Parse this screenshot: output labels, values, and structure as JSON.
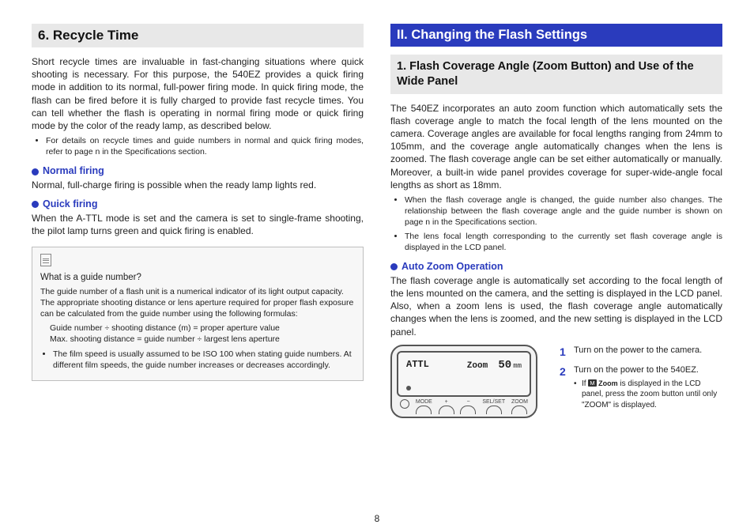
{
  "pageNumber": "8",
  "left": {
    "section_title": "6. Recycle Time",
    "intro": "Short recycle times are invaluable in fast-changing situations where quick shooting is necessary. For this purpose, the 540EZ provides a quick firing mode in addition to its normal, full-power firing mode. In quick firing mode, the flash can be fired before it is fully charged to provide fast recycle times. You can tell whether the flash is operating in normal firing mode or quick firing mode by the color of the ready lamp, as described below.",
    "bullet1": "For details on recycle times and guide numbers in normal and quick firing modes, refer to page n in the Specifications section.",
    "normal_title": "Normal firing",
    "normal_text": "Normal, full-charge firing is possible when the ready lamp lights red.",
    "quick_title": "Quick firing",
    "quick_text": "When the A-TTL mode is set and the camera is set to single-frame shooting, the pilot lamp turns green and quick firing is enabled.",
    "info_title": "What is a guide number?",
    "info_body": "The guide number of a flash unit is a numerical indicator of its light output capacity. The appropriate shooting distance or lens aperture required for proper flash exposure can be calculated from the guide number using the following formulas:",
    "info_formula1": "Guide number ÷ shooting distance (m) = proper aperture value",
    "info_formula2": "Max. shooting distance = guide number ÷ largest lens aperture",
    "info_note": "The film speed is usually assumed to be ISO 100 when stating guide numbers. At different film speeds, the guide number increases or decreases accordingly."
  },
  "right": {
    "chapter_title": "II. Changing the Flash Settings",
    "section_title": "1. Flash Coverage Angle (Zoom Button) and Use of the Wide Panel",
    "intro": "The 540EZ incorporates an auto zoom function which automatically sets the flash coverage angle to match the focal length of the lens mounted on the camera. Coverage angles are available for focal lengths ranging from 24mm to 105mm, and the coverage angle automatically changes when the lens is zoomed. The flash coverage angle can be set either automatically or manually. Moreover, a built-in wide panel provides coverage for super-wide-angle focal lengths as short as 18mm.",
    "bullet1": "When the flash coverage angle is changed, the guide number also changes. The relationship between the flash coverage angle and the guide number is shown on page n in the Specifications section.",
    "bullet2": "The lens focal length corresponding to the currently set flash coverage angle is displayed in the LCD panel.",
    "auto_title": "Auto Zoom Operation",
    "auto_text": "The flash coverage angle is automatically set according to the focal length of the lens mounted on the camera, and the setting is displayed in the LCD panel. Also, when a zoom lens is used, the flash coverage angle automatically changes when the lens is zoomed, and the new setting is displayed in the LCD panel.",
    "lcd": {
      "attl": "ATTL",
      "zoom_label": "Zoom",
      "zoom_value": "50",
      "zoom_unit": "mm",
      "btn_mode": "MODE",
      "btn_plus": "+",
      "btn_minus": "−",
      "btn_selset": "SEL/SET",
      "btn_zoom": "ZOOM"
    },
    "steps": {
      "s1": "Turn on the power to the camera.",
      "s2": "Turn on the power to the 540EZ.",
      "s2_sub_before": "If ",
      "s2_sub_zoom": " Zoom",
      "s2_sub_after": " is displayed in the LCD panel, press the zoom button until only \"ZOOM\" is displayed."
    }
  }
}
